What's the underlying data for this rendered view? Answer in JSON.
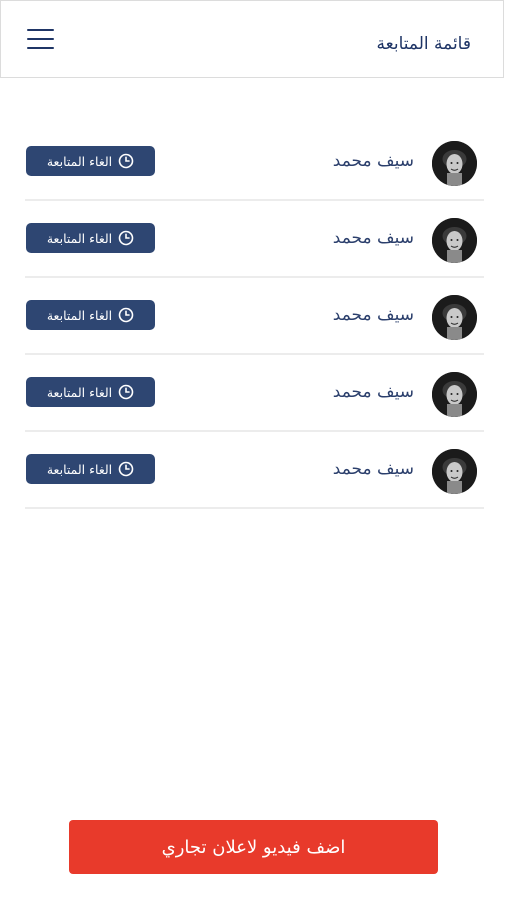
{
  "header": {
    "title": "قائمة المتابعة",
    "menu_icon": "menu-icon"
  },
  "follows": [
    {
      "name": "سيف محمد",
      "action_label": "الغاء المتابعة"
    },
    {
      "name": "سيف محمد",
      "action_label": "الغاء المتابعة"
    },
    {
      "name": "سيف محمد",
      "action_label": "الغاء المتابعة"
    },
    {
      "name": "سيف محمد",
      "action_label": "الغاء المتابعة"
    },
    {
      "name": "سيف محمد",
      "action_label": "الغاء المتابعة"
    }
  ],
  "footer": {
    "add_video_label": "اضف فيديو لاعلان تجاري"
  },
  "colors": {
    "primary_navy": "#2e4672",
    "accent_red": "#e83a2b"
  }
}
